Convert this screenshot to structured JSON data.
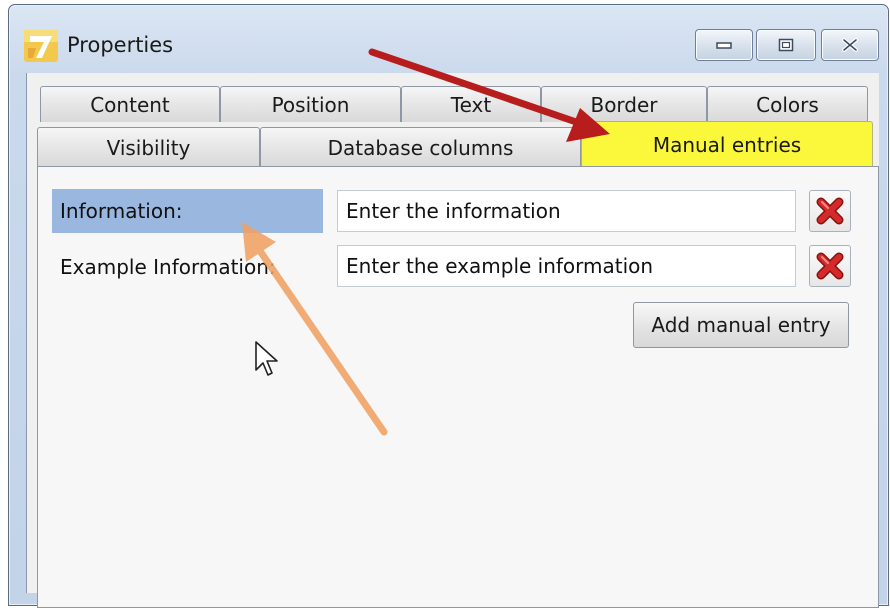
{
  "window": {
    "title": "Properties",
    "icon": "app-logo-icon"
  },
  "tabs": {
    "row1": [
      {
        "label": "Content"
      },
      {
        "label": "Position"
      },
      {
        "label": "Text"
      },
      {
        "label": "Border"
      },
      {
        "label": "Colors"
      }
    ],
    "row2": [
      {
        "label": "Visibility"
      },
      {
        "label": "Database columns"
      },
      {
        "label": "Manual entries",
        "active": true
      }
    ]
  },
  "entries": [
    {
      "label": "Information:",
      "value": "Enter the information",
      "selected": true
    },
    {
      "label": "Example Information:",
      "value": "Enter the example information",
      "selected": false
    }
  ],
  "actions": {
    "add_label": "Add manual entry"
  },
  "colors": {
    "active_tab": "#fbf73b",
    "selected_label": "#9ab7e0",
    "delete_icon": "#d42a2a",
    "annotation_red_arrow": "#b81d1d",
    "annotation_orange_arrow": "#f0a060"
  }
}
